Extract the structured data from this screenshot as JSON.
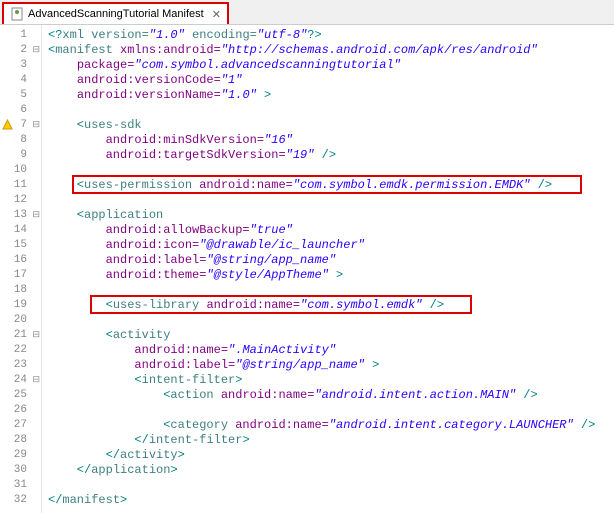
{
  "tab": {
    "title": "AdvancedScanningTutorial Manifest"
  },
  "gutter": {
    "lines": [
      "1",
      "2",
      "3",
      "4",
      "5",
      "6",
      "7",
      "8",
      "9",
      "10",
      "11",
      "12",
      "13",
      "14",
      "15",
      "16",
      "17",
      "18",
      "19",
      "20",
      "21",
      "22",
      "23",
      "24",
      "25",
      "26",
      "27",
      "28",
      "29",
      "30",
      "31",
      "32"
    ],
    "fold_markers_at": [
      2,
      7,
      13,
      21,
      24
    ],
    "warning_at": 7
  },
  "code": {
    "l1": {
      "a": "<?",
      "b": "xml version=",
      "c": "\"1.0\"",
      "d": " encoding=",
      "e": "\"utf-8\"",
      "f": "?>"
    },
    "l2": {
      "a": "<",
      "b": "manifest ",
      "c": "xmlns:android=",
      "d": "\"http://schemas.android.com/apk/res/android\""
    },
    "l3": {
      "a": "    ",
      "b": "package=",
      "c": "\"com.symbol.advancedscanningtutorial\""
    },
    "l4": {
      "a": "    ",
      "b": "android:versionCode=",
      "c": "\"1\""
    },
    "l5": {
      "a": "    ",
      "b": "android:versionName=",
      "c": "\"1.0\"",
      "d": " >"
    },
    "l6": "",
    "l7": {
      "a": "    <",
      "b": "uses-sdk"
    },
    "l8": {
      "a": "        ",
      "b": "android:minSdkVersion=",
      "c": "\"16\""
    },
    "l9": {
      "a": "        ",
      "b": "android:targetSdkVersion=",
      "c": "\"19\"",
      "d": " />"
    },
    "l10": "",
    "l11": {
      "a": "    <",
      "b": "uses-permission ",
      "c": "android:name=",
      "d": "\"com.symbol.emdk.permission.EMDK\"",
      "e": " />"
    },
    "l12": "",
    "l13": {
      "a": "    <",
      "b": "application"
    },
    "l14": {
      "a": "        ",
      "b": "android:allowBackup=",
      "c": "\"true\""
    },
    "l15": {
      "a": "        ",
      "b": "android:icon=",
      "c": "\"@drawable/ic_launcher\""
    },
    "l16": {
      "a": "        ",
      "b": "android:label=",
      "c": "\"@string/app_name\""
    },
    "l17": {
      "a": "        ",
      "b": "android:theme=",
      "c": "\"@style/AppTheme\"",
      "d": " >"
    },
    "l18": "",
    "l19": {
      "a": "        <",
      "b": "uses-library ",
      "c": "android:name=",
      "d": "\"com.symbol.emdk\"",
      "e": " />"
    },
    "l20": "",
    "l21": {
      "a": "        <",
      "b": "activity"
    },
    "l22": {
      "a": "            ",
      "b": "android:name=",
      "c": "\".MainActivity\""
    },
    "l23": {
      "a": "            ",
      "b": "android:label=",
      "c": "\"@string/app_name\"",
      "d": " >"
    },
    "l24": {
      "a": "            <",
      "b": "intent-filter",
      "c": ">"
    },
    "l25": {
      "a": "                <",
      "b": "action ",
      "c": "android:name=",
      "d": "\"android.intent.action.MAIN\"",
      "e": " />"
    },
    "l26": "",
    "l27": {
      "a": "                <",
      "b": "category ",
      "c": "android:name=",
      "d": "\"android.intent.category.LAUNCHER\"",
      "e": " />"
    },
    "l28": {
      "a": "            </",
      "b": "intent-filter",
      "c": ">"
    },
    "l29": {
      "a": "        </",
      "b": "activity",
      "c": ">"
    },
    "l30": {
      "a": "    </",
      "b": "application",
      "c": ">"
    },
    "l31": "",
    "l32": {
      "a": "</",
      "b": "manifest",
      "c": ">"
    }
  }
}
